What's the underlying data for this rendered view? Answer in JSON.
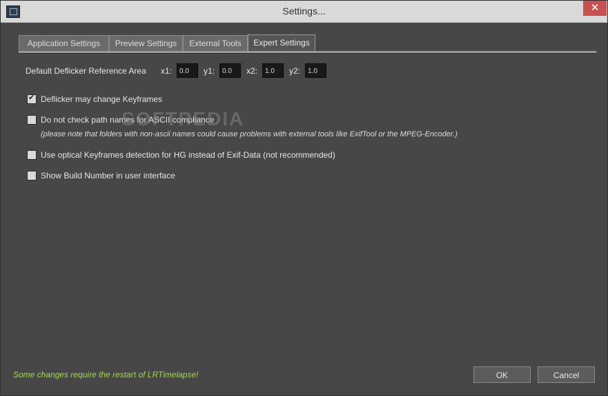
{
  "window": {
    "title": "Settings...",
    "close_symbol": "✕"
  },
  "tabs": [
    {
      "label": "Application Settings"
    },
    {
      "label": "Preview Settings"
    },
    {
      "label": "External Tools"
    },
    {
      "label": "Expert Settings"
    }
  ],
  "active_tab": "Expert Settings",
  "deflicker_area": {
    "label": "Default Deflicker Reference Area",
    "x1_label": "x1:",
    "x1_value": "0.0",
    "y1_label": "y1:",
    "y1_value": "0.0",
    "x2_label": "x2:",
    "x2_value": "1.0",
    "y2_label": "y2:",
    "y2_value": "1.0"
  },
  "options": [
    {
      "label": "Deflicker may change Keyframes",
      "checked": true
    },
    {
      "label": "Do not check path names for ASCII compliance",
      "checked": false
    },
    {
      "label": "Use optical Keyframes detection for HG instead of Exif-Data (not recommended)",
      "checked": false
    },
    {
      "label": "Show Build Number in user interface",
      "checked": false
    }
  ],
  "ascii_note": "(please note that folders with non-ascii names could cause problems with external tools like ExifTool or the MPEG-Encoder.)",
  "watermark": "SOFTPEDIA",
  "footer": {
    "restart_note": "Some changes require the restart of LRTimelapse!",
    "ok_label": "OK",
    "cancel_label": "Cancel"
  },
  "colors": {
    "background": "#474747",
    "restart_note": "#a8d84a",
    "close_button": "#c75050"
  },
  "icons": {
    "app": "lrtimelapse-app-icon",
    "close": "close-icon",
    "check": "checkmark-icon"
  }
}
